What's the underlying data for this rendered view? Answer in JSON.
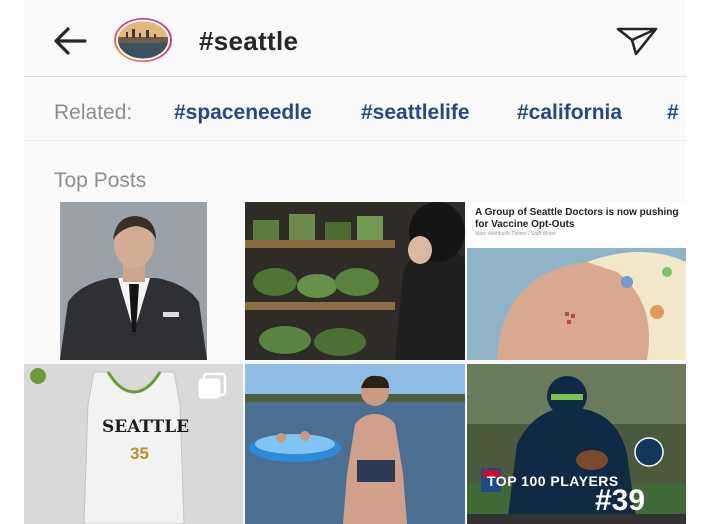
{
  "header": {
    "title": "#seattle",
    "back_icon": "arrow-left-icon",
    "send_icon": "paper-plane-icon"
  },
  "related": {
    "label": "Related:",
    "tags": [
      "#spaceneedle",
      "#seattlelife",
      "#california",
      "#"
    ]
  },
  "section_title": "Top Posts",
  "posts": [
    {
      "kind": "photo"
    },
    {
      "kind": "photo"
    },
    {
      "kind": "news",
      "headline": "A Group of Seattle Doctors is now pushing for Vaccine Opt-Outs",
      "byline": "Marc Weinbuch-Theme / Staff Writer"
    },
    {
      "kind": "photo",
      "jersey_text": "SEATTLE",
      "jersey_number": "35",
      "multi_icon": "carousel-icon"
    },
    {
      "kind": "photo"
    },
    {
      "kind": "photo",
      "overlay_text": "TOP 100 PLAYERS",
      "overlay_number": "#39"
    }
  ],
  "colors": {
    "hashtag": "#28478a",
    "muted": "#8e8e8e",
    "title": "#262626"
  }
}
